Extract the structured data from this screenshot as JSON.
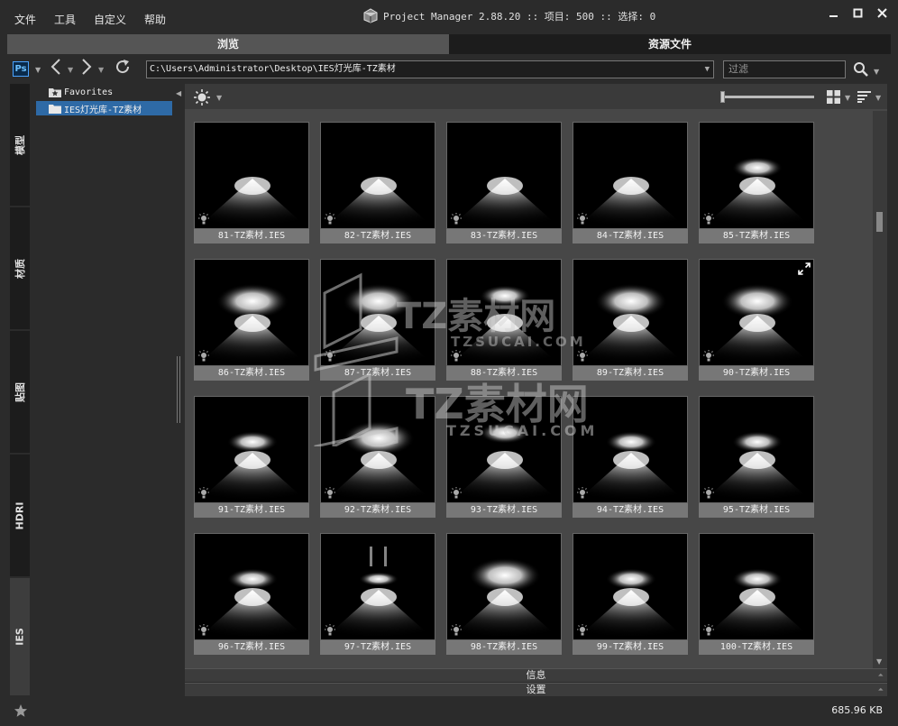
{
  "menu": [
    "文件",
    "工具",
    "自定义",
    "帮助"
  ],
  "title": "Project Manager 2.88.20  :: 项目: 500  :: 选择: 0",
  "window_controls": {
    "minimize": "✕",
    "maximize": "□",
    "close": "✕"
  },
  "tabs": [
    {
      "label": "浏览",
      "active": true
    },
    {
      "label": "资源文件",
      "active": false
    }
  ],
  "address": {
    "app_badge": "Ps",
    "path": "C:\\Users\\Administrator\\Desktop\\IES灯光库-TZ素材",
    "filter_placeholder": "过滤"
  },
  "side_tabs": [
    "模型",
    "材质",
    "贴图",
    "HDRI",
    "IES"
  ],
  "side_tab_active": "IES",
  "tree": [
    {
      "label": "Favorites",
      "icon": "star-folder-icon",
      "selected": false
    },
    {
      "label": "IES灯光库-TZ素材",
      "icon": "folder-icon",
      "selected": true
    }
  ],
  "thumbnails": [
    "81-TZ素材.IES",
    "82-TZ素材.IES",
    "83-TZ素材.IES",
    "84-TZ素材.IES",
    "85-TZ素材.IES",
    "86-TZ素材.IES",
    "87-TZ素材.IES",
    "88-TZ素材.IES",
    "89-TZ素材.IES",
    "90-TZ素材.IES",
    "91-TZ素材.IES",
    "92-TZ素材.IES",
    "93-TZ素材.IES",
    "94-TZ素材.IES",
    "95-TZ素材.IES",
    "96-TZ素材.IES",
    "97-TZ素材.IES",
    "98-TZ素材.IES",
    "99-TZ素材.IES",
    "100-TZ素材.IES"
  ],
  "panels": {
    "info": "信息",
    "settings": "设置"
  },
  "status": {
    "size": "685.96 KB"
  },
  "watermark": {
    "brand": "TZ素材网",
    "url": "TZSUCAI.COM"
  },
  "colors": {
    "accent": "#2e6aa6",
    "pane": "#474747",
    "bg": "#2b2b2b"
  }
}
